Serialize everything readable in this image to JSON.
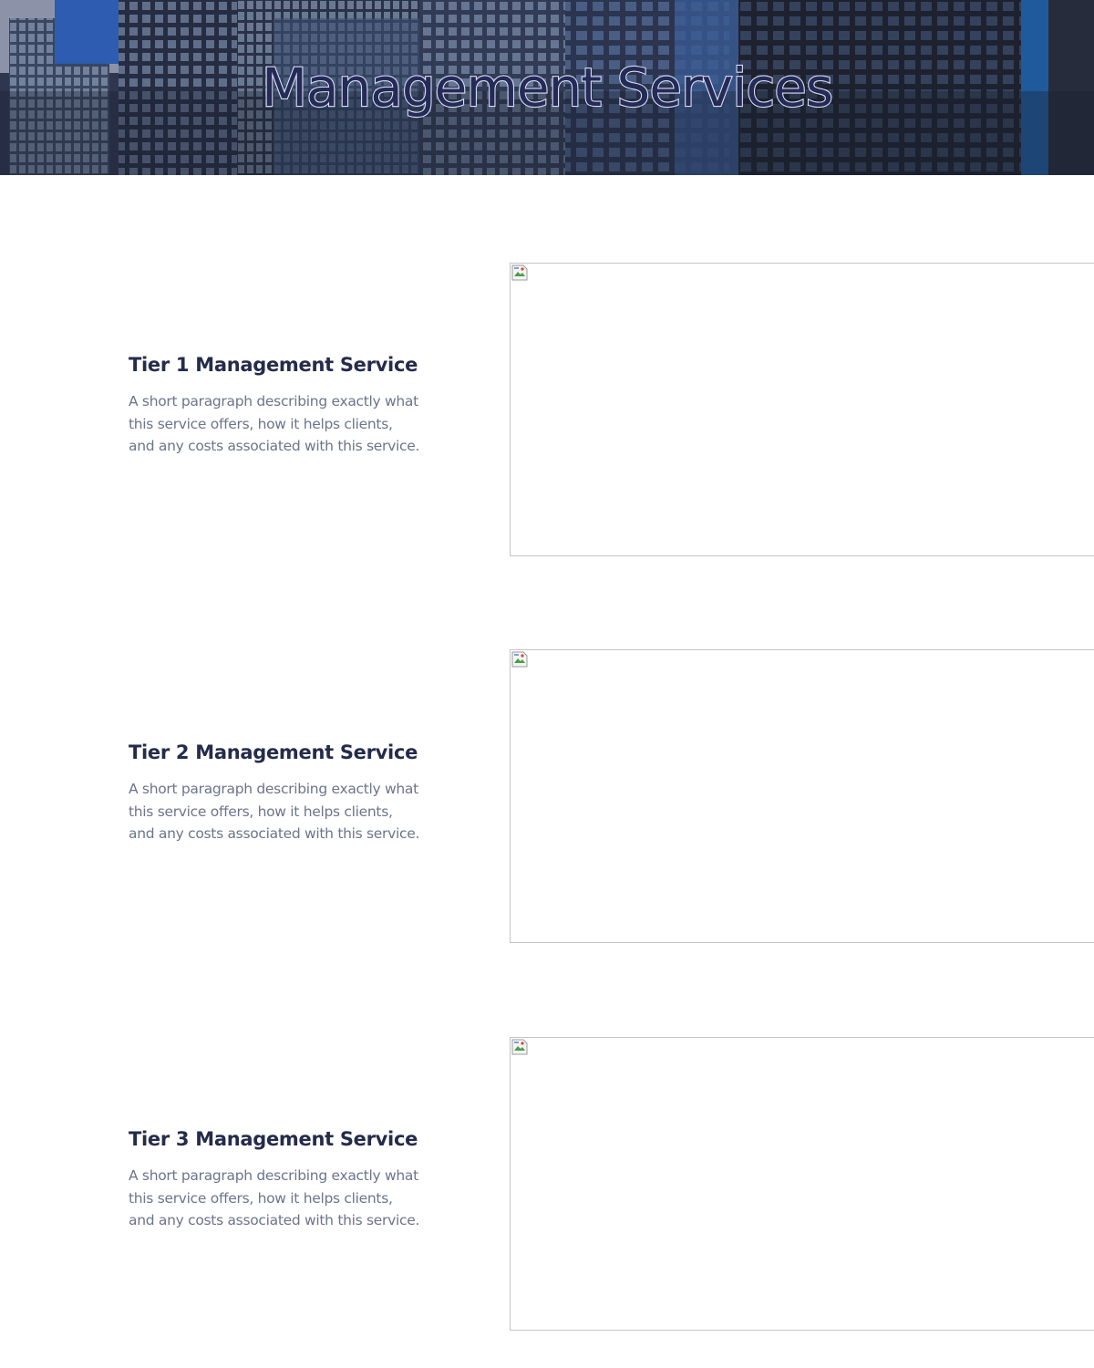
{
  "hero": {
    "title": "Management Services"
  },
  "services": [
    {
      "title": "Tier 1 Management Service",
      "description": "A short paragraph describing exactly what this service offers, how it helps clients, and any costs associated with this service.",
      "image_icon": "broken-image-icon"
    },
    {
      "title": "Tier 2 Management Service",
      "description": "A short paragraph describing exactly what this service offers, how it helps clients, and any costs associated with this service.",
      "image_icon": "broken-image-icon"
    },
    {
      "title": "Tier 3 Management Service",
      "description": "A short paragraph describing exactly what this service offers, how it helps clients, and any costs associated with this service.",
      "image_icon": "broken-image-icon"
    }
  ],
  "colors": {
    "title_fill": "#242b57",
    "title_outline": "#d8dcf2",
    "heading": "#252b4a",
    "body_text": "#6d748c",
    "image_border": "#c4c4c4"
  }
}
